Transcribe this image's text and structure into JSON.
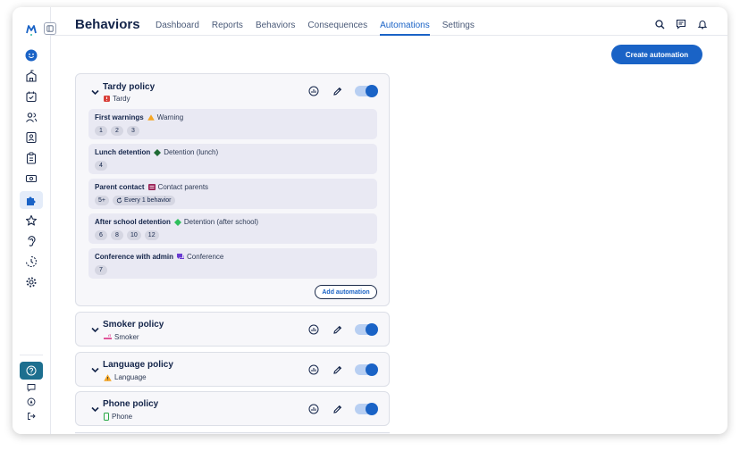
{
  "app": {
    "title": "Behaviors"
  },
  "nav": {
    "items": [
      "Dashboard",
      "Reports",
      "Behaviors",
      "Consequences",
      "Automations",
      "Settings"
    ],
    "active": "Automations"
  },
  "actions": {
    "create_label": "Create automation",
    "add_label": "Add automation"
  },
  "policies": [
    {
      "title": "Tardy policy",
      "behavior": "Tardy",
      "rules": [
        {
          "title": "First warnings",
          "consequence": "Warning",
          "pills": [
            "1",
            "2",
            "3"
          ]
        },
        {
          "title": "Lunch detention",
          "consequence": "Detention (lunch)",
          "pills": [
            "4"
          ]
        },
        {
          "title": "Parent contact",
          "consequence": "Contact parents",
          "pills": [
            "5+"
          ],
          "every": "Every 1 behavior"
        },
        {
          "title": "After school detention",
          "consequence": "Detention (after school)",
          "pills": [
            "6",
            "8",
            "10",
            "12"
          ]
        },
        {
          "title": "Conference with admin",
          "consequence": "Conference",
          "pills": [
            "7"
          ]
        }
      ]
    },
    {
      "title": "Smoker policy",
      "behavior": "Smoker"
    },
    {
      "title": "Language policy",
      "behavior": "Language"
    },
    {
      "title": "Phone policy",
      "behavior": "Phone"
    }
  ],
  "colors": {
    "accent": "#1a63c6",
    "help": "#1d6f8f",
    "warning": "#f5a623",
    "detention_lunch": "#1f6b34",
    "contact": "#9b2257",
    "detention_after": "#2fbf5c",
    "conference": "#6a3bd1",
    "tardy": "#d9413b",
    "smoker": "#e0559a",
    "phone": "#27a844"
  }
}
